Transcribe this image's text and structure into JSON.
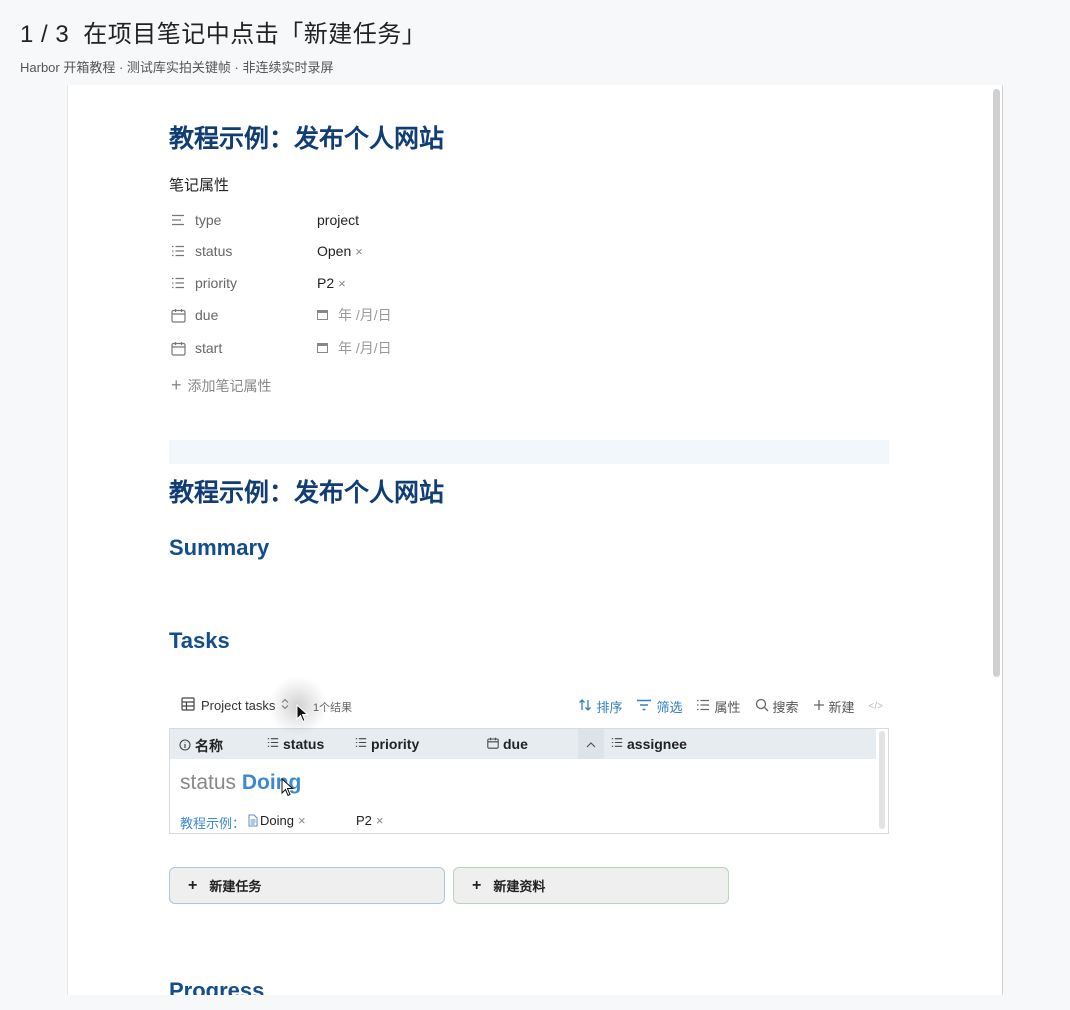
{
  "header": {
    "step": "1 / 3",
    "title": "在项目笔记中点击「新建任务」",
    "subtitle": "Harbor 开箱教程 · 测试库实拍关键帧 · 非连续实时录屏"
  },
  "note": {
    "title": "教程示例：发布个人网站",
    "properties_heading": "笔记属性",
    "properties": [
      {
        "icon": "text-lines-icon",
        "name": "type",
        "value": "project",
        "removable": false
      },
      {
        "icon": "list-icon",
        "name": "status",
        "value": "Open",
        "removable": true
      },
      {
        "icon": "list-icon",
        "name": "priority",
        "value": "P2",
        "removable": true
      },
      {
        "icon": "calendar-icon",
        "name": "due",
        "value": "年 /月/日",
        "date": true
      },
      {
        "icon": "calendar-icon",
        "name": "start",
        "value": "年 /月/日",
        "date": true
      }
    ],
    "add_property": "添加笔记属性",
    "remove_symbol": "×",
    "plus_symbol": "+"
  },
  "document": {
    "title": "教程示例：发布个人网站",
    "sections": {
      "summary": "Summary",
      "tasks": "Tasks",
      "progress": "Progress"
    }
  },
  "database": {
    "view_name": "Project tasks",
    "result_count": "1个结果",
    "actions": {
      "sort": "排序",
      "filter": "筛选",
      "properties": "属性",
      "search": "搜索",
      "new": "新建",
      "code": "</>"
    },
    "columns": [
      "名称",
      "status",
      "priority",
      "due",
      "assignee"
    ],
    "group": {
      "label": "status",
      "value": "Doing"
    },
    "rows": [
      {
        "name": "教程示例：",
        "status": "Doing",
        "priority": "P2"
      }
    ]
  },
  "buttons": {
    "new_task": "新建任务",
    "new_resource": "新建资料"
  }
}
